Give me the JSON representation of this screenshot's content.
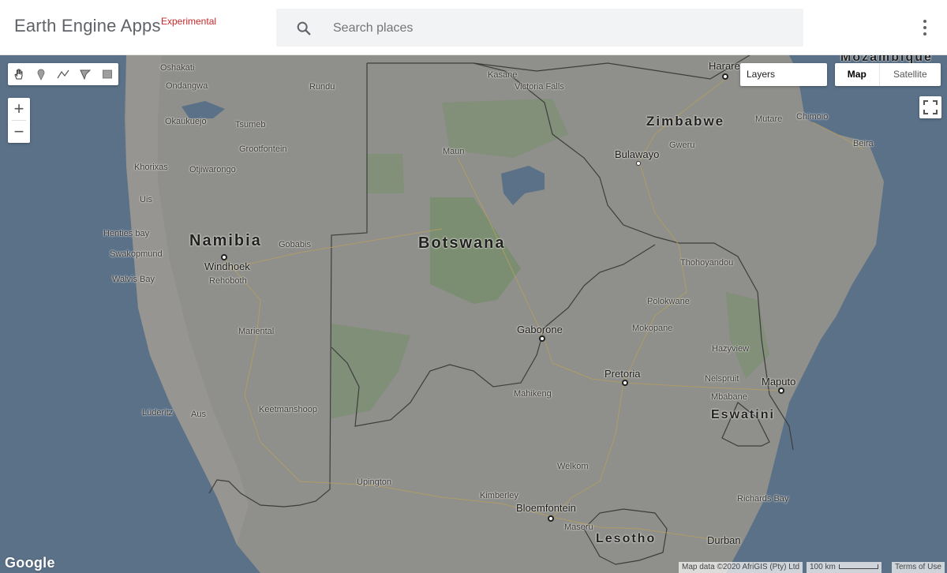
{
  "header": {
    "brand": "Earth Engine Apps",
    "badge": "Experimental",
    "search_placeholder": "Search places"
  },
  "icons": {
    "search": "search-icon",
    "more": "more-vert-icon",
    "pan": "hand-icon",
    "point": "marker-icon",
    "line": "polyline-icon",
    "polygon": "polygon-icon",
    "rectangle": "rectangle-icon",
    "fullscreen": "fullscreen-icon"
  },
  "controls": {
    "zoom_in": "+",
    "zoom_out": "−",
    "layers": "Layers",
    "map_type": {
      "map": "Map",
      "satellite": "Satellite",
      "selected": "Map"
    }
  },
  "map": {
    "countries": [
      "Namibia",
      "Botswana",
      "Zimbabwe",
      "Mozambique",
      "Eswatini",
      "Lesotho"
    ],
    "cities": [
      "Harare",
      "Gweru",
      "Bulawayo",
      "Mutare",
      "Chimoio",
      "Beira",
      "Windhoek",
      "Gobabis",
      "Rehoboth",
      "Gaborone",
      "Pretoria",
      "Maputo",
      "Mbabane",
      "Bloemfontein",
      "Maseru",
      "Durban",
      "Kimberley",
      "Welkom",
      "Polokwane",
      "Nelspruit",
      "Mahikeng",
      "Upington",
      "Lüderitz"
    ],
    "towns": [
      "Oshakati",
      "Ondangwa",
      "Rundu",
      "Kasane",
      "Victoria Falls",
      "Okaukuejo",
      "Tsumeb",
      "Grootfontein",
      "Khorixas",
      "Otjiwarongo",
      "Uis",
      "Henties bay",
      "Swakopmund",
      "Walvis Bay",
      "Maun",
      "Mariental",
      "Keetmanshoop",
      "Aus",
      "Thohoyandou",
      "Mokopane",
      "Hazyview",
      "Richards Bay"
    ]
  },
  "footer": {
    "logo": "Google",
    "map_data": "Map data ©2020 AfriGIS (Pty) Ltd",
    "scale": "100 km",
    "terms": "Terms of Use"
  },
  "colors": {
    "ocean": "#5b7188",
    "land": "#8f8f8b",
    "park": "#7c8e72",
    "header_bg": "#ffffff",
    "search_bg": "#f1f3f4",
    "badge": "#c62828"
  }
}
